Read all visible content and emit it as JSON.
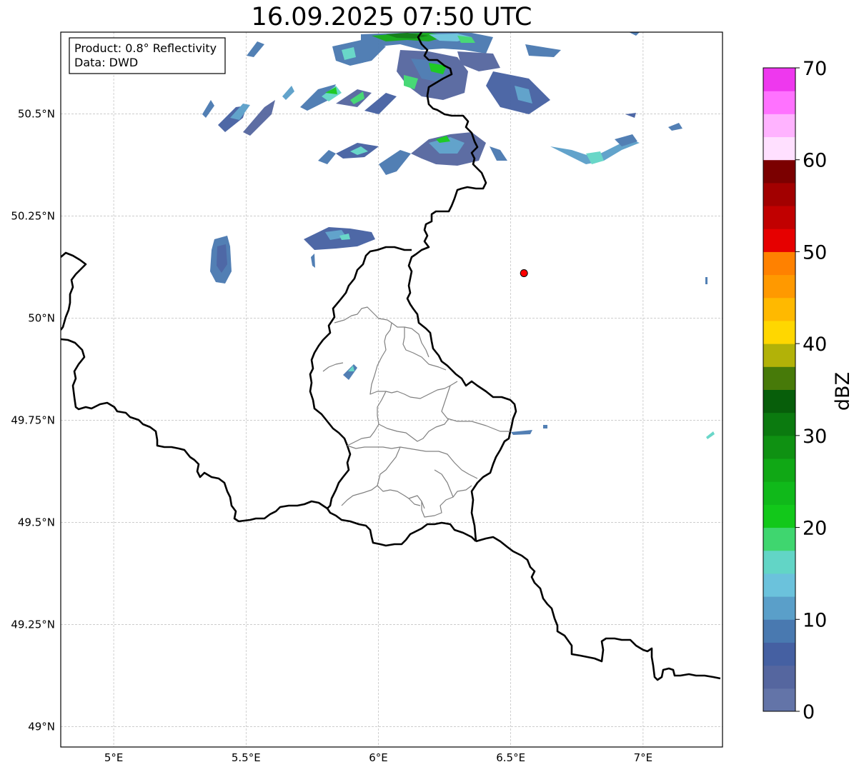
{
  "map": {
    "title": "16.09.2025 07:50 UTC",
    "info_box": {
      "product_line": "Product: 0.8° Reflectivity",
      "data_line": "Data: DWD"
    },
    "extent": {
      "lon": [
        4.8,
        7.3
      ],
      "lat": [
        48.95,
        50.7
      ]
    },
    "lon_ticks": [
      {
        "value": 5.0,
        "label": "5°E"
      },
      {
        "value": 5.5,
        "label": "5.5°E"
      },
      {
        "value": 6.0,
        "label": "6°E"
      },
      {
        "value": 6.5,
        "label": "6.5°E"
      },
      {
        "value": 7.0,
        "label": "7°E"
      }
    ],
    "lat_ticks": [
      {
        "value": 50.5,
        "label": "50.5°N"
      },
      {
        "value": 50.25,
        "label": "50.25°N"
      },
      {
        "value": 50.0,
        "label": "50°N"
      },
      {
        "value": 49.75,
        "label": "49.75°N"
      },
      {
        "value": 49.5,
        "label": "49.5°N"
      },
      {
        "value": 49.25,
        "label": "49.25°N"
      },
      {
        "value": 49.0,
        "label": "49°N"
      }
    ],
    "gridlines": true,
    "marker": {
      "lon": 6.55,
      "lat": 50.11,
      "color": "#ff0000"
    },
    "layers": [
      "radar-reflectivity",
      "country-borders",
      "luxembourg-canton-borders"
    ],
    "colorbar": {
      "label": "dBZ",
      "min": 0,
      "max": 70,
      "step": 2.5,
      "tick_labels": [
        "0",
        "10",
        "20",
        "30",
        "40",
        "50",
        "60",
        "70"
      ],
      "colors": [
        "#6374a8",
        "#55669f",
        "#4560a2",
        "#4979b0",
        "#5a9fc9",
        "#6bc2dc",
        "#62d5c6",
        "#3fd66f",
        "#12c81a",
        "#10b91a",
        "#10a815",
        "#0f9112",
        "#0b7a0f",
        "#075e0a",
        "#477a09",
        "#b2b208",
        "#ffd700",
        "#ffb900",
        "#ff9900",
        "#ff8100",
        "#e60000",
        "#c10000",
        "#a20000",
        "#7b0000",
        "#ffe0ff",
        "#ffb3ff",
        "#ff72ff",
        "#ee38ee"
      ]
    }
  }
}
